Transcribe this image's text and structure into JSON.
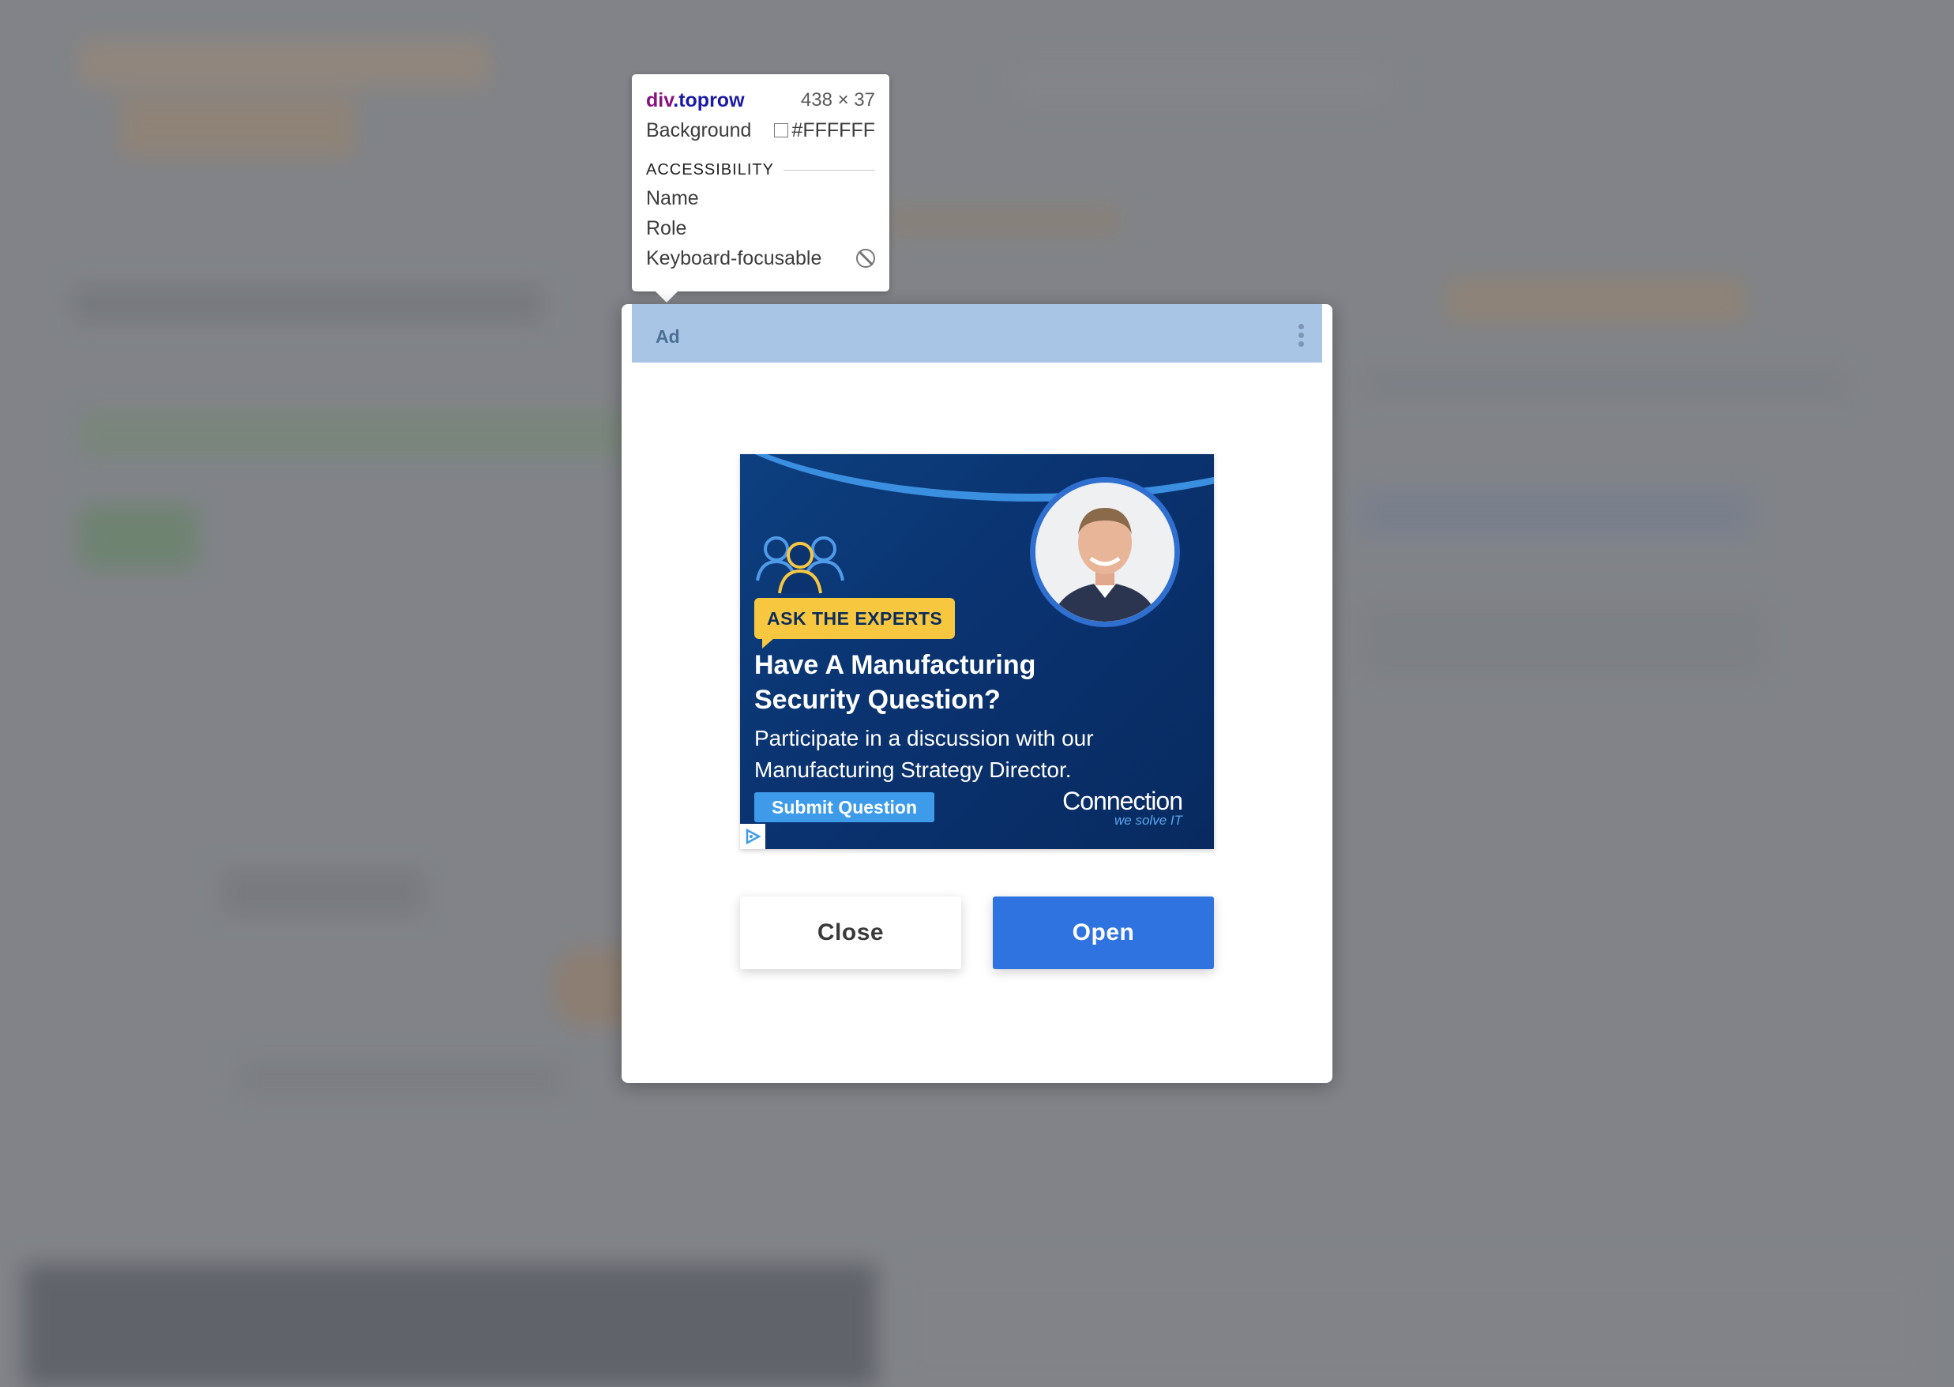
{
  "inspector": {
    "tag": "div",
    "class": ".toprow",
    "dimensions": "438 × 37",
    "background_label": "Background",
    "background_value": "#FFFFFF",
    "section_title": "ACCESSIBILITY",
    "name_label": "Name",
    "role_label": "Role",
    "keyboard_label": "Keyboard-focusable",
    "keyboard_icon": "blocked-icon"
  },
  "dialog": {
    "ad_label": "Ad",
    "menu_icon": "more-vertical-icon",
    "close_label": "Close",
    "open_label": "Open"
  },
  "creative": {
    "tagline": "ASK THE EXPERTS",
    "headline_line1": "Have A Manufacturing",
    "headline_line2": "Security Question?",
    "body_line1": "Participate in a discussion with our",
    "body_line2": "Manufacturing Strategy Director.",
    "cta": "Submit Question",
    "brand": "Connection",
    "brand_tagline": "we solve IT",
    "adchoices_icon": "adchoices-icon",
    "people_icon": "people-group-icon"
  },
  "colors": {
    "toprow_bg": "#a8c5e6",
    "open_button": "#2f73e0",
    "creative_bg": "#0a3370",
    "tagline_bg": "#f7c740",
    "cta_bg": "#3d9be9"
  }
}
